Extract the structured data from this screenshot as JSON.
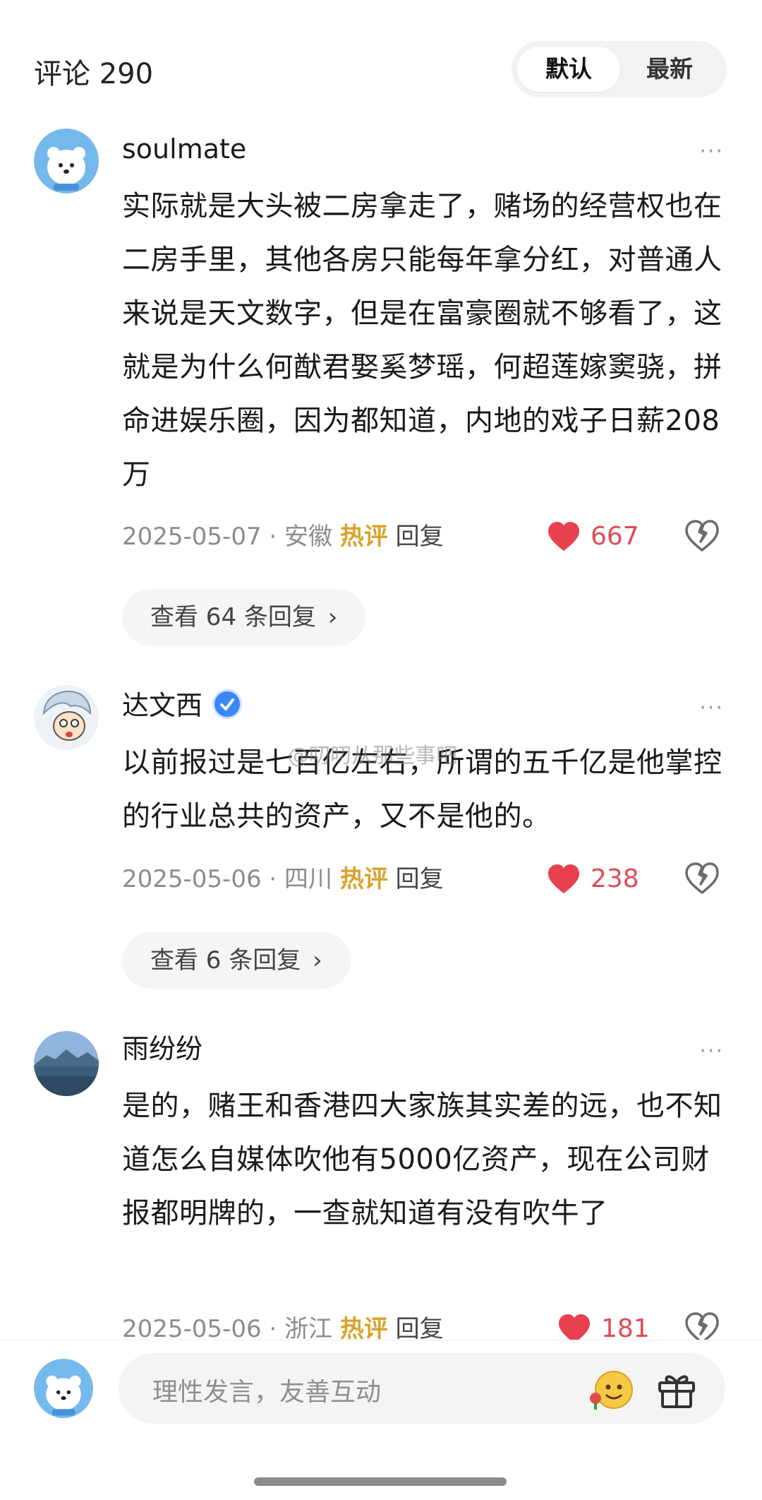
{
  "header": {
    "title": "评论 290",
    "sort_default": "默认",
    "sort_latest": "最新"
  },
  "comments": [
    {
      "username": "soulmate",
      "verified": false,
      "text": "实际就是大头被二房拿走了，赌场的经营权也在二房手里，其他各房只能每年拿分红，对普通人来说是天文数字，但是在富豪圈就不够看了，这就是为什么何猷君娶奚梦瑶，何超莲嫁窦骁，拼命进娱乐圈，因为都知道，内地的戏子日薪208万",
      "date": "2025-05-07",
      "location": "安徽",
      "hot_label": "热评",
      "reply_label": "回复",
      "likes": "667",
      "view_replies": "查看 64 条回复",
      "avatar_icon": "polar-bear-avatar-icon"
    },
    {
      "username": "达文西",
      "verified": true,
      "text": "以前报过是七百亿左右，所谓的五千亿是他掌控的行业总共的资产，又不是他的。",
      "date": "2025-05-06",
      "location": "四川",
      "hot_label": "热评",
      "reply_label": "回复",
      "likes": "238",
      "view_replies": "查看 6 条回复",
      "avatar_icon": "cartoon-character-avatar-icon"
    },
    {
      "username": "雨纷纷",
      "verified": false,
      "text": "是的，赌王和香港四大家族其实差的远，也不知道怎么自媒体吹他有5000亿资产，现在公司财报都明牌的，一查就知道有没有吹牛了",
      "date": "2025-05-06",
      "location": "浙江",
      "hot_label": "热评",
      "reply_label": "回复",
      "likes": "181",
      "view_replies": "",
      "avatar_icon": "lake-landscape-avatar-icon"
    }
  ],
  "separator": " · ",
  "more_glyph": "···",
  "chevron_glyph": "›",
  "watermark": "@叨叨从那些事吧",
  "bottom_bar": {
    "placeholder": "理性发言，友善互动"
  },
  "colors": {
    "like_red": "#e8404e",
    "hot_gold": "#d8a32d",
    "meta_gray": "#8c8c8c",
    "verify_blue": "#3d86f5"
  }
}
